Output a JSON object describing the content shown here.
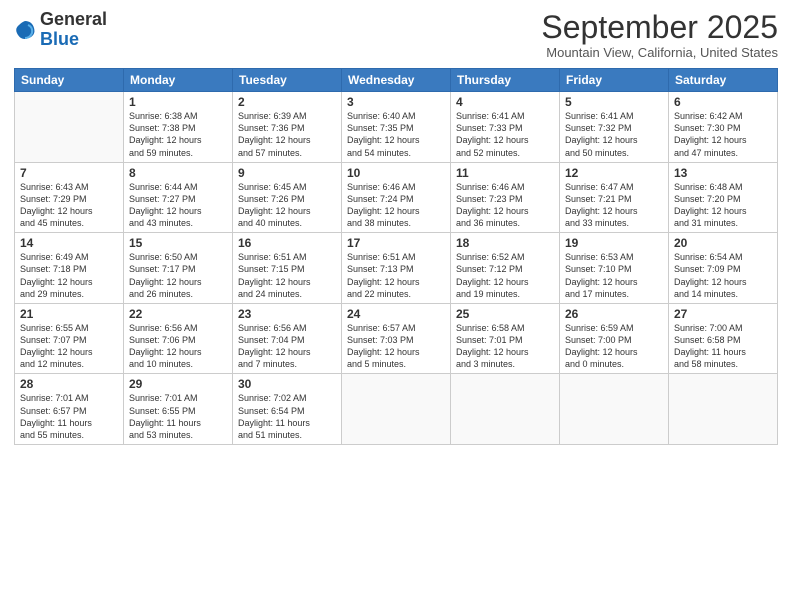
{
  "logo": {
    "general": "General",
    "blue": "Blue"
  },
  "title": "September 2025",
  "location": "Mountain View, California, United States",
  "days_of_week": [
    "Sunday",
    "Monday",
    "Tuesday",
    "Wednesday",
    "Thursday",
    "Friday",
    "Saturday"
  ],
  "weeks": [
    [
      {
        "day": "",
        "info": ""
      },
      {
        "day": "1",
        "info": "Sunrise: 6:38 AM\nSunset: 7:38 PM\nDaylight: 12 hours\nand 59 minutes."
      },
      {
        "day": "2",
        "info": "Sunrise: 6:39 AM\nSunset: 7:36 PM\nDaylight: 12 hours\nand 57 minutes."
      },
      {
        "day": "3",
        "info": "Sunrise: 6:40 AM\nSunset: 7:35 PM\nDaylight: 12 hours\nand 54 minutes."
      },
      {
        "day": "4",
        "info": "Sunrise: 6:41 AM\nSunset: 7:33 PM\nDaylight: 12 hours\nand 52 minutes."
      },
      {
        "day": "5",
        "info": "Sunrise: 6:41 AM\nSunset: 7:32 PM\nDaylight: 12 hours\nand 50 minutes."
      },
      {
        "day": "6",
        "info": "Sunrise: 6:42 AM\nSunset: 7:30 PM\nDaylight: 12 hours\nand 47 minutes."
      }
    ],
    [
      {
        "day": "7",
        "info": "Sunrise: 6:43 AM\nSunset: 7:29 PM\nDaylight: 12 hours\nand 45 minutes."
      },
      {
        "day": "8",
        "info": "Sunrise: 6:44 AM\nSunset: 7:27 PM\nDaylight: 12 hours\nand 43 minutes."
      },
      {
        "day": "9",
        "info": "Sunrise: 6:45 AM\nSunset: 7:26 PM\nDaylight: 12 hours\nand 40 minutes."
      },
      {
        "day": "10",
        "info": "Sunrise: 6:46 AM\nSunset: 7:24 PM\nDaylight: 12 hours\nand 38 minutes."
      },
      {
        "day": "11",
        "info": "Sunrise: 6:46 AM\nSunset: 7:23 PM\nDaylight: 12 hours\nand 36 minutes."
      },
      {
        "day": "12",
        "info": "Sunrise: 6:47 AM\nSunset: 7:21 PM\nDaylight: 12 hours\nand 33 minutes."
      },
      {
        "day": "13",
        "info": "Sunrise: 6:48 AM\nSunset: 7:20 PM\nDaylight: 12 hours\nand 31 minutes."
      }
    ],
    [
      {
        "day": "14",
        "info": "Sunrise: 6:49 AM\nSunset: 7:18 PM\nDaylight: 12 hours\nand 29 minutes."
      },
      {
        "day": "15",
        "info": "Sunrise: 6:50 AM\nSunset: 7:17 PM\nDaylight: 12 hours\nand 26 minutes."
      },
      {
        "day": "16",
        "info": "Sunrise: 6:51 AM\nSunset: 7:15 PM\nDaylight: 12 hours\nand 24 minutes."
      },
      {
        "day": "17",
        "info": "Sunrise: 6:51 AM\nSunset: 7:13 PM\nDaylight: 12 hours\nand 22 minutes."
      },
      {
        "day": "18",
        "info": "Sunrise: 6:52 AM\nSunset: 7:12 PM\nDaylight: 12 hours\nand 19 minutes."
      },
      {
        "day": "19",
        "info": "Sunrise: 6:53 AM\nSunset: 7:10 PM\nDaylight: 12 hours\nand 17 minutes."
      },
      {
        "day": "20",
        "info": "Sunrise: 6:54 AM\nSunset: 7:09 PM\nDaylight: 12 hours\nand 14 minutes."
      }
    ],
    [
      {
        "day": "21",
        "info": "Sunrise: 6:55 AM\nSunset: 7:07 PM\nDaylight: 12 hours\nand 12 minutes."
      },
      {
        "day": "22",
        "info": "Sunrise: 6:56 AM\nSunset: 7:06 PM\nDaylight: 12 hours\nand 10 minutes."
      },
      {
        "day": "23",
        "info": "Sunrise: 6:56 AM\nSunset: 7:04 PM\nDaylight: 12 hours\nand 7 minutes."
      },
      {
        "day": "24",
        "info": "Sunrise: 6:57 AM\nSunset: 7:03 PM\nDaylight: 12 hours\nand 5 minutes."
      },
      {
        "day": "25",
        "info": "Sunrise: 6:58 AM\nSunset: 7:01 PM\nDaylight: 12 hours\nand 3 minutes."
      },
      {
        "day": "26",
        "info": "Sunrise: 6:59 AM\nSunset: 7:00 PM\nDaylight: 12 hours\nand 0 minutes."
      },
      {
        "day": "27",
        "info": "Sunrise: 7:00 AM\nSunset: 6:58 PM\nDaylight: 11 hours\nand 58 minutes."
      }
    ],
    [
      {
        "day": "28",
        "info": "Sunrise: 7:01 AM\nSunset: 6:57 PM\nDaylight: 11 hours\nand 55 minutes."
      },
      {
        "day": "29",
        "info": "Sunrise: 7:01 AM\nSunset: 6:55 PM\nDaylight: 11 hours\nand 53 minutes."
      },
      {
        "day": "30",
        "info": "Sunrise: 7:02 AM\nSunset: 6:54 PM\nDaylight: 11 hours\nand 51 minutes."
      },
      {
        "day": "",
        "info": ""
      },
      {
        "day": "",
        "info": ""
      },
      {
        "day": "",
        "info": ""
      },
      {
        "day": "",
        "info": ""
      }
    ]
  ]
}
